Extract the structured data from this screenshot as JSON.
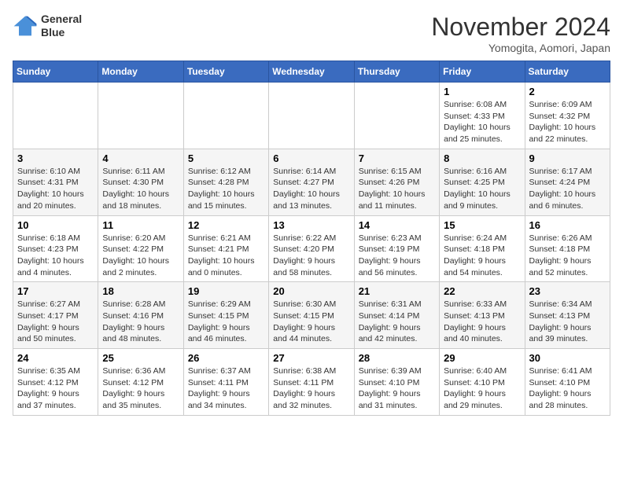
{
  "header": {
    "logo_line1": "General",
    "logo_line2": "Blue",
    "title": "November 2024",
    "subtitle": "Yomogita, Aomori, Japan"
  },
  "weekdays": [
    "Sunday",
    "Monday",
    "Tuesday",
    "Wednesday",
    "Thursday",
    "Friday",
    "Saturday"
  ],
  "weeks": [
    [
      {
        "day": "",
        "info": ""
      },
      {
        "day": "",
        "info": ""
      },
      {
        "day": "",
        "info": ""
      },
      {
        "day": "",
        "info": ""
      },
      {
        "day": "",
        "info": ""
      },
      {
        "day": "1",
        "info": "Sunrise: 6:08 AM\nSunset: 4:33 PM\nDaylight: 10 hours and 25 minutes."
      },
      {
        "day": "2",
        "info": "Sunrise: 6:09 AM\nSunset: 4:32 PM\nDaylight: 10 hours and 22 minutes."
      }
    ],
    [
      {
        "day": "3",
        "info": "Sunrise: 6:10 AM\nSunset: 4:31 PM\nDaylight: 10 hours and 20 minutes."
      },
      {
        "day": "4",
        "info": "Sunrise: 6:11 AM\nSunset: 4:30 PM\nDaylight: 10 hours and 18 minutes."
      },
      {
        "day": "5",
        "info": "Sunrise: 6:12 AM\nSunset: 4:28 PM\nDaylight: 10 hours and 15 minutes."
      },
      {
        "day": "6",
        "info": "Sunrise: 6:14 AM\nSunset: 4:27 PM\nDaylight: 10 hours and 13 minutes."
      },
      {
        "day": "7",
        "info": "Sunrise: 6:15 AM\nSunset: 4:26 PM\nDaylight: 10 hours and 11 minutes."
      },
      {
        "day": "8",
        "info": "Sunrise: 6:16 AM\nSunset: 4:25 PM\nDaylight: 10 hours and 9 minutes."
      },
      {
        "day": "9",
        "info": "Sunrise: 6:17 AM\nSunset: 4:24 PM\nDaylight: 10 hours and 6 minutes."
      }
    ],
    [
      {
        "day": "10",
        "info": "Sunrise: 6:18 AM\nSunset: 4:23 PM\nDaylight: 10 hours and 4 minutes."
      },
      {
        "day": "11",
        "info": "Sunrise: 6:20 AM\nSunset: 4:22 PM\nDaylight: 10 hours and 2 minutes."
      },
      {
        "day": "12",
        "info": "Sunrise: 6:21 AM\nSunset: 4:21 PM\nDaylight: 10 hours and 0 minutes."
      },
      {
        "day": "13",
        "info": "Sunrise: 6:22 AM\nSunset: 4:20 PM\nDaylight: 9 hours and 58 minutes."
      },
      {
        "day": "14",
        "info": "Sunrise: 6:23 AM\nSunset: 4:19 PM\nDaylight: 9 hours and 56 minutes."
      },
      {
        "day": "15",
        "info": "Sunrise: 6:24 AM\nSunset: 4:18 PM\nDaylight: 9 hours and 54 minutes."
      },
      {
        "day": "16",
        "info": "Sunrise: 6:26 AM\nSunset: 4:18 PM\nDaylight: 9 hours and 52 minutes."
      }
    ],
    [
      {
        "day": "17",
        "info": "Sunrise: 6:27 AM\nSunset: 4:17 PM\nDaylight: 9 hours and 50 minutes."
      },
      {
        "day": "18",
        "info": "Sunrise: 6:28 AM\nSunset: 4:16 PM\nDaylight: 9 hours and 48 minutes."
      },
      {
        "day": "19",
        "info": "Sunrise: 6:29 AM\nSunset: 4:15 PM\nDaylight: 9 hours and 46 minutes."
      },
      {
        "day": "20",
        "info": "Sunrise: 6:30 AM\nSunset: 4:15 PM\nDaylight: 9 hours and 44 minutes."
      },
      {
        "day": "21",
        "info": "Sunrise: 6:31 AM\nSunset: 4:14 PM\nDaylight: 9 hours and 42 minutes."
      },
      {
        "day": "22",
        "info": "Sunrise: 6:33 AM\nSunset: 4:13 PM\nDaylight: 9 hours and 40 minutes."
      },
      {
        "day": "23",
        "info": "Sunrise: 6:34 AM\nSunset: 4:13 PM\nDaylight: 9 hours and 39 minutes."
      }
    ],
    [
      {
        "day": "24",
        "info": "Sunrise: 6:35 AM\nSunset: 4:12 PM\nDaylight: 9 hours and 37 minutes."
      },
      {
        "day": "25",
        "info": "Sunrise: 6:36 AM\nSunset: 4:12 PM\nDaylight: 9 hours and 35 minutes."
      },
      {
        "day": "26",
        "info": "Sunrise: 6:37 AM\nSunset: 4:11 PM\nDaylight: 9 hours and 34 minutes."
      },
      {
        "day": "27",
        "info": "Sunrise: 6:38 AM\nSunset: 4:11 PM\nDaylight: 9 hours and 32 minutes."
      },
      {
        "day": "28",
        "info": "Sunrise: 6:39 AM\nSunset: 4:10 PM\nDaylight: 9 hours and 31 minutes."
      },
      {
        "day": "29",
        "info": "Sunrise: 6:40 AM\nSunset: 4:10 PM\nDaylight: 9 hours and 29 minutes."
      },
      {
        "day": "30",
        "info": "Sunrise: 6:41 AM\nSunset: 4:10 PM\nDaylight: 9 hours and 28 minutes."
      }
    ]
  ]
}
